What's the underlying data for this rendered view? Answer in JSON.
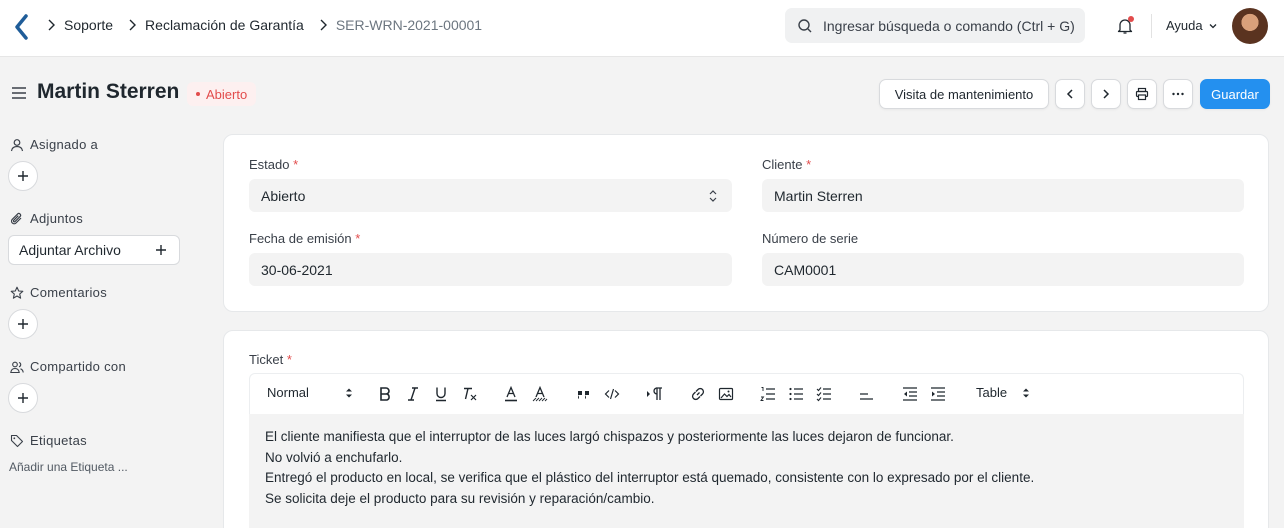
{
  "navbar": {
    "breadcrumbs": [
      "Soporte",
      "Reclamación de Garantía",
      "SER-WRN-2021-00001"
    ],
    "search_placeholder": "Ingresar búsqueda o comando (Ctrl + G)",
    "help_label": "Ayuda"
  },
  "header": {
    "title": "Martin Sterren",
    "status": "Abierto",
    "maintenance_button": "Visita de mantenimiento",
    "save_button": "Guardar"
  },
  "sidebar": {
    "assigned_label": "Asignado a",
    "attachments_label": "Adjuntos",
    "attach_button": "Adjuntar Archivo",
    "comments_label": "Comentarios",
    "shared_label": "Compartido con",
    "tags_label": "Etiquetas",
    "add_tag": "Añadir una Etiqueta ..."
  },
  "form": {
    "estado_label": "Estado",
    "estado_value": "Abierto",
    "cliente_label": "Cliente",
    "cliente_value": "Martin Sterren",
    "fecha_label": "Fecha de emisión",
    "fecha_value": "30-06-2021",
    "serie_label": "Número de serie",
    "serie_value": "CAM0001"
  },
  "ticket": {
    "label": "Ticket",
    "format_select": "Normal",
    "table_select": "Table",
    "lines": [
      "El cliente manifiesta que el interruptor de las luces largó chispazos y posteriormente las luces dejaron de funcionar.",
      "No volvió a enchufarlo.",
      "Entregó el producto en local, se verifica que el plástico del interruptor está quemado, consistente con lo expresado por el cliente.",
      "Se solicita deje el producto para su revisión y reparación/cambio."
    ]
  },
  "colors": {
    "primary": "#2490ef",
    "danger": "#e24c4c",
    "text": "#1f272e"
  }
}
